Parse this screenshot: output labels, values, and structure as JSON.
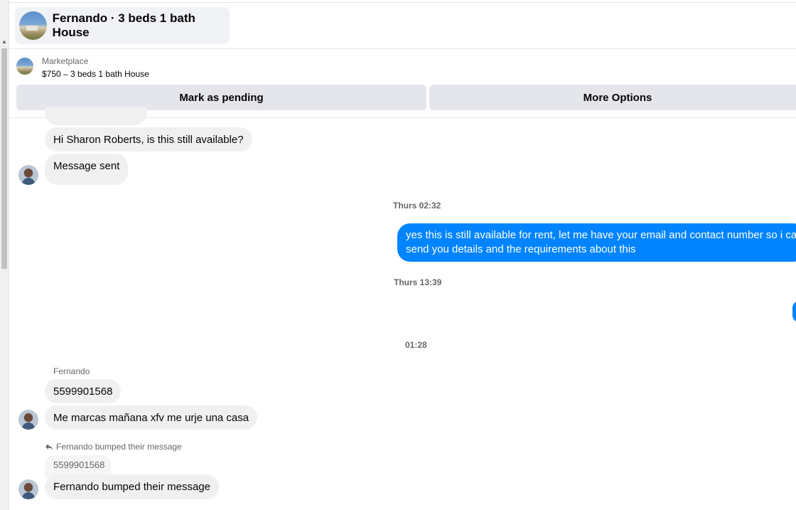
{
  "header": {
    "title": "Fernando · 3 beds 1 bath House"
  },
  "marketplace": {
    "label": "Marketplace",
    "listing": "$750 – 3 beds 1 bath House"
  },
  "actions": {
    "pending_label": "Mark as pending",
    "more_label": "More Options"
  },
  "messages": {
    "greeting": "Hi Sharon Roberts, is this still available?",
    "sent_status": "Message sent",
    "ts1": "Thurs 02:32",
    "reply_line1": "yes this is still available for rent, let me have your email  and contact number so i can",
    "reply_line2": "send you details and the requirements about this",
    "ts2": "Thurs 13:39",
    "ts3": "01:28",
    "sender": "Fernando",
    "phone": "5599901568",
    "spanish": "Me marcas mañana xfv me urje una casa",
    "bump_note": "Fernando bumped their message",
    "quoted_phone": "5599901568",
    "bump_bubble": "Fernando bumped their message"
  },
  "colors": {
    "accent": "#0084ff",
    "bubble_bg": "#f0f0f0",
    "button_bg": "#e4e6eb"
  },
  "icons": {
    "reply": "reply-arrow-icon"
  }
}
